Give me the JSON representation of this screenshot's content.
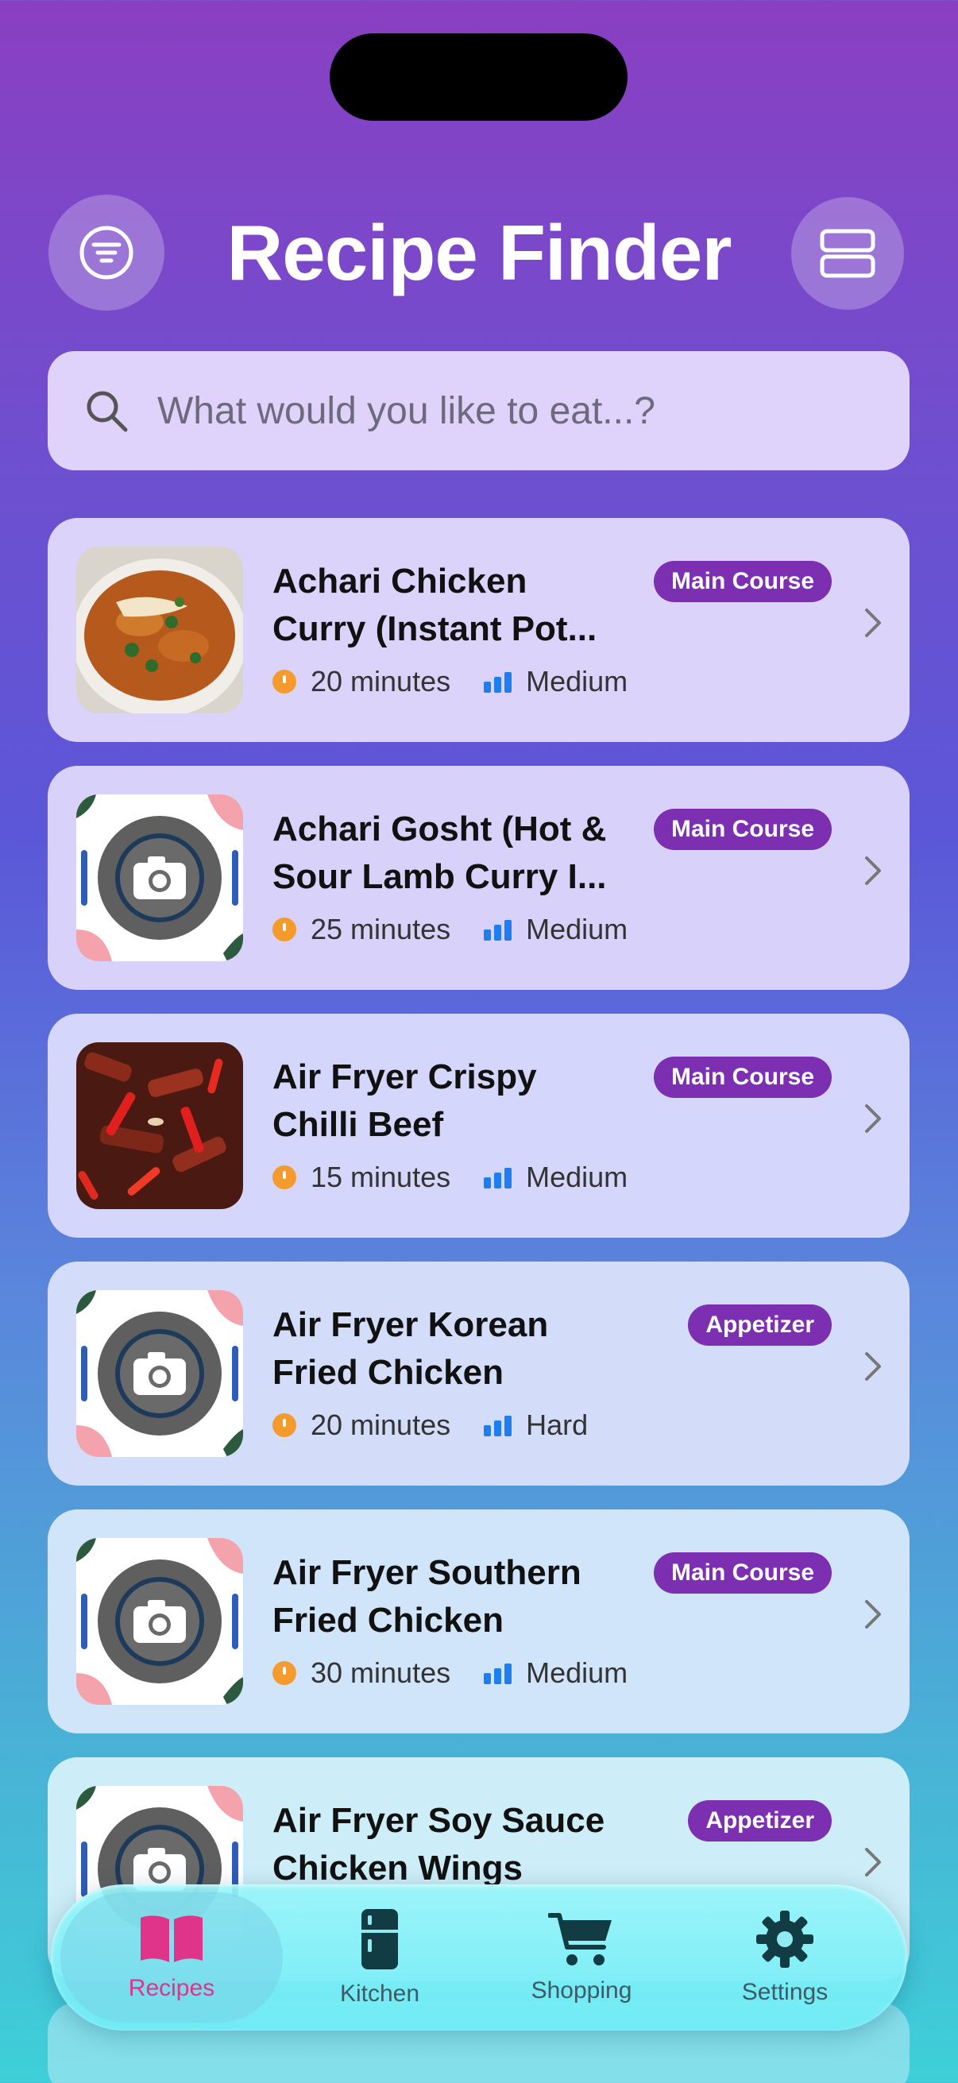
{
  "header": {
    "title": "Recipe Finder",
    "filter_icon": "filter-icon",
    "layout_icon": "layout-toggle-icon"
  },
  "search": {
    "placeholder": "What would you like to eat...?",
    "icon": "search-icon"
  },
  "recipes": [
    {
      "title": "Achari Chicken\nCurry (Instant Pot...",
      "category": "Main Course",
      "time": "20 minutes",
      "difficulty": "Medium",
      "image": "curry-photo"
    },
    {
      "title": "Achari Gosht (Hot &\nSour Lamb Curry I...",
      "category": "Main Course",
      "time": "25 minutes",
      "difficulty": "Medium",
      "image": "placeholder"
    },
    {
      "title": "Air Fryer Crispy\nChilli Beef",
      "category": "Main Course",
      "time": "15 minutes",
      "difficulty": "Medium",
      "image": "beef-photo"
    },
    {
      "title": "Air Fryer Korean\nFried Chicken",
      "category": "Appetizer",
      "time": "20 minutes",
      "difficulty": "Hard",
      "image": "placeholder"
    },
    {
      "title": "Air Fryer Southern\nFried Chicken",
      "category": "Main Course",
      "time": "30 minutes",
      "difficulty": "Medium",
      "image": "placeholder"
    },
    {
      "title": "Air Fryer Soy Sauce\nChicken Wings",
      "category": "Appetizer",
      "time": "",
      "difficulty": "",
      "image": "placeholder"
    }
  ],
  "tabs": [
    {
      "label": "Recipes",
      "icon": "book-icon",
      "active": true
    },
    {
      "label": "Kitchen",
      "icon": "fridge-icon",
      "active": false
    },
    {
      "label": "Shopping",
      "icon": "cart-icon",
      "active": false
    },
    {
      "label": "Settings",
      "icon": "gear-icon",
      "active": false
    }
  ],
  "colors": {
    "badge": "#7d2fb1",
    "active_tab": "#e0338a",
    "clock": "#f59a2c",
    "difficulty_bars": "#1e7ef0"
  }
}
